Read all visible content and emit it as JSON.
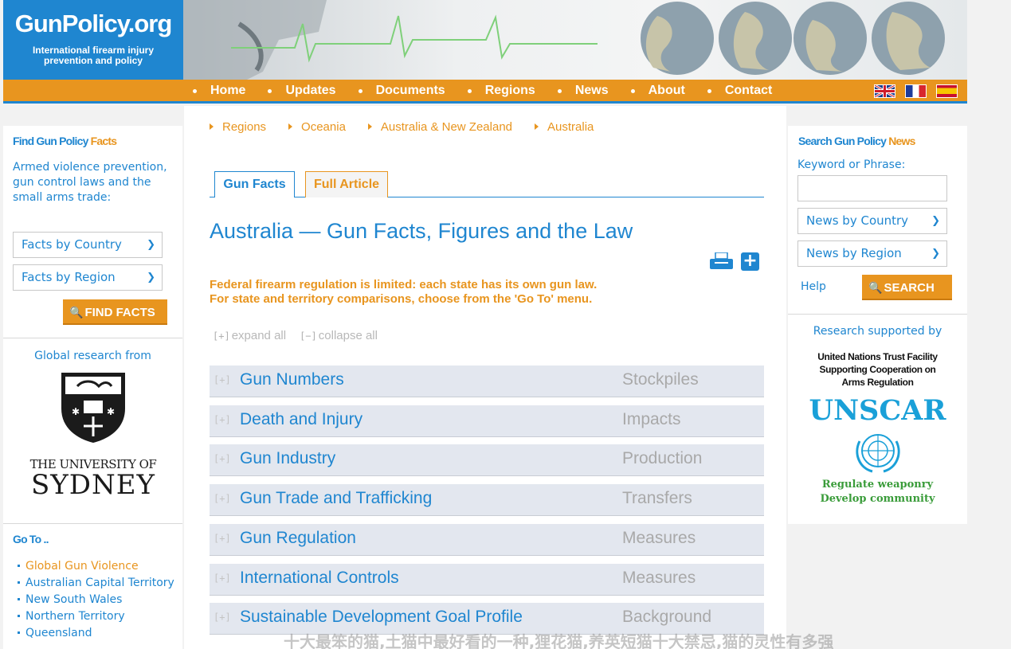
{
  "header": {
    "brand": "GunPolicy.org",
    "tagline_line1": "International firearm injury",
    "tagline_line2": "prevention and policy"
  },
  "nav": {
    "items": [
      "Home",
      "Updates",
      "Documents",
      "Regions",
      "News",
      "About",
      "Contact"
    ],
    "flags": [
      "flag-uk-icon",
      "flag-france-icon",
      "flag-spain-icon"
    ]
  },
  "left": {
    "heading": "Find Gun Policy",
    "heading_accent": "Facts",
    "intro": "Armed violence prevention, gun control laws and the small arms trade:",
    "select_country": "Facts by Country",
    "select_region": "Facts by Region",
    "find_button": "FIND FACTS",
    "research_label": "Global research from",
    "uni_line1": "THE UNIVERSITY OF",
    "uni_line2": "SYDNEY",
    "goto_heading": "Go To ..",
    "goto_items": [
      "Global Gun Violence",
      "Australian Capital Territory",
      "New South Wales",
      "Northern Territory",
      "Queensland"
    ]
  },
  "main": {
    "breadcrumbs": [
      "Regions",
      "Oceania",
      "Australia & New Zealand",
      "Australia"
    ],
    "tab_gun_facts": "Gun Facts",
    "tab_full_article": "Full Article",
    "title": "Australia — Gun Facts, Figures and the Law",
    "notice_line1": "Federal firearm regulation is limited: each state has its own gun law.",
    "notice_line2": "For state and territory comparisons, choose from the 'Go To' menu.",
    "expand_all": "expand all",
    "collapse_all": "collapse all",
    "plus_bracket": "[+]",
    "minus_bracket": "[−]",
    "rows": [
      {
        "title": "Gun Numbers",
        "category": "Stockpiles"
      },
      {
        "title": "Death and Injury",
        "category": "Impacts"
      },
      {
        "title": "Gun Industry",
        "category": "Production"
      },
      {
        "title": "Gun Trade and Trafficking",
        "category": "Transfers"
      },
      {
        "title": "Gun Regulation",
        "category": "Measures"
      },
      {
        "title": "International Controls",
        "category": "Measures"
      },
      {
        "title": "Sustainable Development Goal Profile",
        "category": "Background"
      }
    ]
  },
  "right": {
    "heading": "Search Gun Policy",
    "heading_accent": "News",
    "keyword_label": "Keyword or Phrase:",
    "keyword_value": "",
    "select_country": "News by Country",
    "select_region": "News by Region",
    "help": "Help",
    "search_button": "SEARCH",
    "research_label": "Research supported by",
    "un_line1": "United Nations Trust Facility",
    "un_line2": "Supporting Cooperation on",
    "un_line3": "Arms Regulation",
    "unscar": "UNSCAR",
    "slogan1": "Regulate weaponry",
    "slogan2": "Develop community"
  },
  "overlay_text": "十大最笨的猫,土猫中最好看的一种,狸花猫,养英短猫十大禁忌,猫的灵性有多强",
  "colors": {
    "blue": "#1f86d0",
    "orange": "#e8951f",
    "row_bg": "#e3e7ef"
  }
}
